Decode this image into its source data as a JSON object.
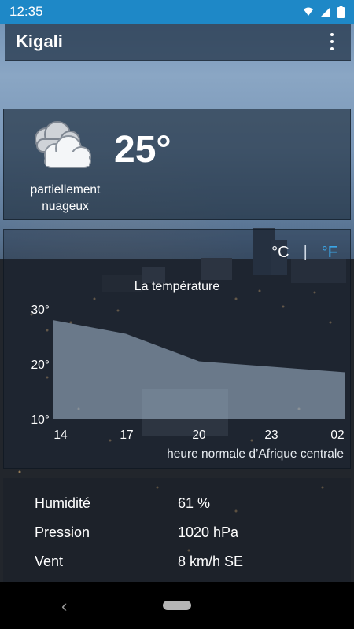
{
  "status_bar": {
    "time": "12:35"
  },
  "app_bar": {
    "title": "Kigali"
  },
  "current": {
    "temperature": "25°",
    "condition_line1": "partiellement",
    "condition_line2": "nuageux"
  },
  "units": {
    "celsius": "°C",
    "separator": "|",
    "fahrenheit": "°F",
    "selected": "°C"
  },
  "chart_data": {
    "type": "area",
    "title": "La température",
    "xlabel": "heure normale d’Afrique centrale",
    "ylabel": "",
    "categories": [
      "14",
      "17",
      "20",
      "23",
      "02"
    ],
    "y_ticks": [
      "30°",
      "20°",
      "10°"
    ],
    "ylim": [
      10,
      30
    ],
    "values": [
      28,
      25.5,
      20.5,
      19.5,
      18.5
    ],
    "fill_color": "#a9bfd6"
  },
  "details": {
    "humidity_label": "Humidité",
    "humidity_value": "61 %",
    "pressure_label": "Pression",
    "pressure_value": "1020 hPa",
    "wind_label": "Vent",
    "wind_value": "8 km/h SE"
  }
}
